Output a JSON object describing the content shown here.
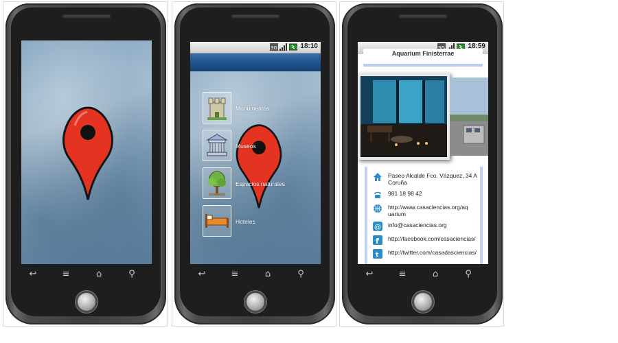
{
  "screens": [
    {
      "name": "splash",
      "status_time": ""
    },
    {
      "name": "menu",
      "status_time": "18:10",
      "menu_items": [
        {
          "label": "Monumentos",
          "icon": "castle-tower-icon"
        },
        {
          "label": "Museos",
          "icon": "museum-building-icon"
        },
        {
          "label": "Espacios naturales",
          "icon": "tree-icon"
        },
        {
          "label": "Hoteles",
          "icon": "bed-icon"
        }
      ]
    },
    {
      "name": "detail",
      "status_time": "18:59",
      "title": "Aquarium Finisterrae",
      "info": {
        "address": "Paseo Alcalde Fco. Vázquez, 34 A Coruña",
        "phone": "981 18 98 42",
        "website": "http://www.casaciencias.org/aquarium",
        "email": "info@casaciencias.org",
        "facebook": "http://facebook.com/casaciencias/",
        "twitter": "http://twitter.com/casadasciencias/"
      }
    }
  ],
  "colors": {
    "pin_red": "#e53322",
    "title_blue": "#1d4f87",
    "info_accent": "#2a8fc9"
  },
  "nav_icons": [
    "back-icon",
    "menu-icon",
    "home-icon",
    "search-icon"
  ]
}
